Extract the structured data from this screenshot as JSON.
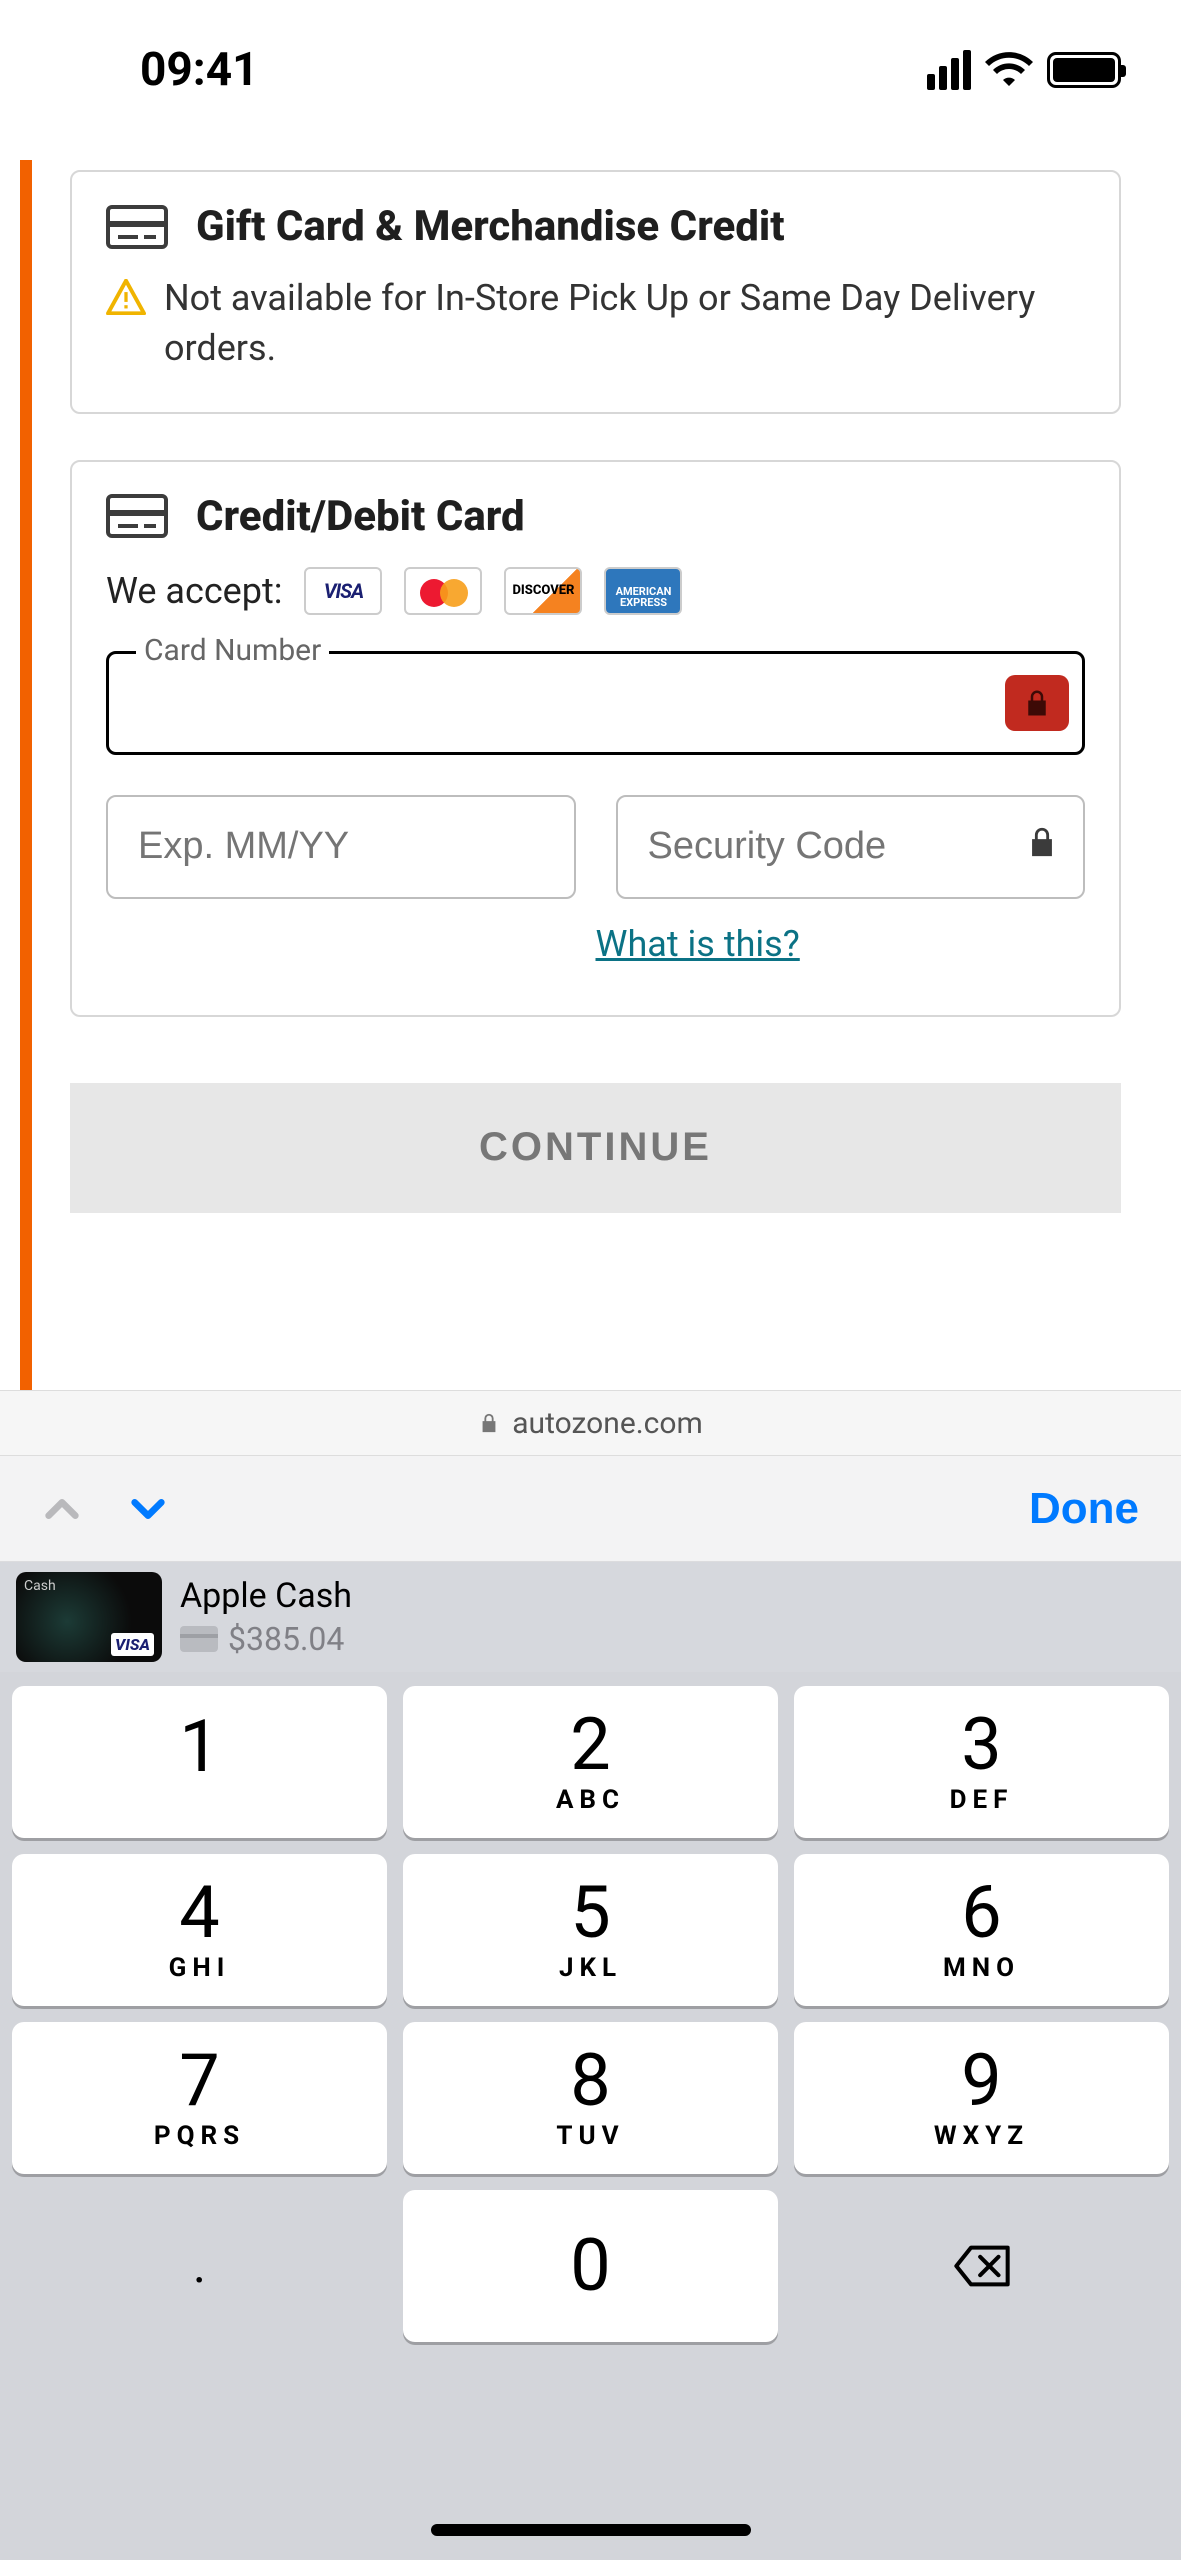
{
  "status_bar": {
    "time": "09:41"
  },
  "gift_card": {
    "title": "Gift Card & Merchandise Credit",
    "warning": "Not available for In-Store Pick Up or Same Day Delivery orders."
  },
  "credit_card": {
    "title": "Credit/Debit Card",
    "accept_label": "We accept:",
    "logos": {
      "visa": "VISA",
      "discover": "DISCOVER",
      "amex": "AMERICAN EXPRESS"
    },
    "card_number_label": "Card Number",
    "card_number_value": "",
    "exp_placeholder": "Exp. MM/YY",
    "exp_value": "",
    "cvv_placeholder": "Security Code",
    "cvv_value": "",
    "help_link": "What is this?"
  },
  "continue_label": "CONTINUE",
  "address_bar": {
    "domain": "autozone.com"
  },
  "kb_accessory": {
    "done": "Done"
  },
  "wallet": {
    "name": "Apple Cash",
    "amount": "$385.04"
  },
  "keypad": {
    "keys": [
      {
        "n": "1",
        "l": ""
      },
      {
        "n": "2",
        "l": "ABC"
      },
      {
        "n": "3",
        "l": "DEF"
      },
      {
        "n": "4",
        "l": "GHI"
      },
      {
        "n": "5",
        "l": "JKL"
      },
      {
        "n": "6",
        "l": "MNO"
      },
      {
        "n": "7",
        "l": "PQRS"
      },
      {
        "n": "8",
        "l": "TUV"
      },
      {
        "n": "9",
        "l": "WXYZ"
      }
    ],
    "dot": ".",
    "zero": "0"
  }
}
